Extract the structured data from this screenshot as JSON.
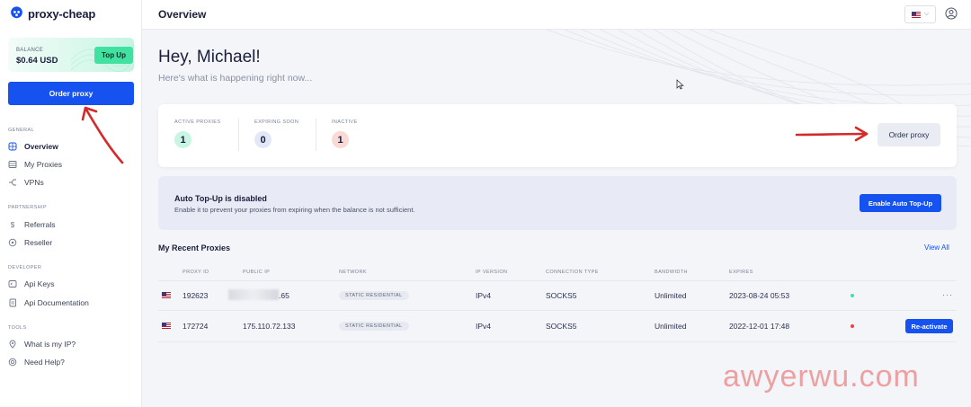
{
  "brand": {
    "name": "proxy-cheap"
  },
  "sidebar": {
    "balance_label": "BALANCE",
    "balance_value": "$0.64 USD",
    "topup_label": "Top Up",
    "order_label": "Order proxy",
    "sections": {
      "general": "GENERAL",
      "partnership": "PARTNERSHIP",
      "developer": "DEVELOPER",
      "tools": "TOOLS"
    },
    "items": [
      {
        "label": "Overview",
        "icon": "globe-icon"
      },
      {
        "label": "My Proxies",
        "icon": "list-icon"
      },
      {
        "label": "VPNs",
        "icon": "vpn-icon"
      },
      {
        "label": "Referrals",
        "icon": "dollar-icon"
      },
      {
        "label": "Reseller",
        "icon": "tag-icon"
      },
      {
        "label": "Api Keys",
        "icon": "key-icon"
      },
      {
        "label": "Api Documentation",
        "icon": "doc-icon"
      },
      {
        "label": "What is my IP?",
        "icon": "location-icon"
      },
      {
        "label": "Need Help?",
        "icon": "help-icon"
      }
    ]
  },
  "header": {
    "title": "Overview"
  },
  "main": {
    "greeting": "Hey, Michael!",
    "subgreeting": "Here's what is happening right now...",
    "stats": [
      {
        "label": "ACTIVE PROXIES",
        "value": "1",
        "color": "#c9f5e3"
      },
      {
        "label": "EXPIRING SOON",
        "value": "0",
        "color": "#e4e7f7"
      },
      {
        "label": "INACTIVE",
        "value": "1",
        "color": "#fbd9d4"
      }
    ],
    "order_label": "Order proxy",
    "autotopup": {
      "title": "Auto Top-Up is disabled",
      "description": "Enable it to prevent your proxies from expiring when the balance is not sufficient.",
      "button": "Enable Auto Top-Up"
    },
    "recent": {
      "title": "My Recent Proxies",
      "view_all": "View All",
      "columns": [
        "PROXY ID",
        "PUBLIC IP",
        "NETWORK",
        "IP VERSION",
        "CONNECTION TYPE",
        "BANDWIDTH",
        "EXPIRES"
      ],
      "rows": [
        {
          "id": "192623",
          "ip": "65",
          "network": "STATIC RESIDENTIAL",
          "version": "IPv4",
          "type": "SOCKS5",
          "bandwidth": "Unlimited",
          "expires": "2023-08-24 05:53",
          "status_color": "#41e1a2",
          "action": "···"
        },
        {
          "id": "172724",
          "ip": "175.110.72.133",
          "network": "STATIC RESIDENTIAL",
          "version": "IPv4",
          "type": "SOCKS5",
          "bandwidth": "Unlimited",
          "expires": "2022-12-01 17:48",
          "status_color": "#e8453c",
          "action": "Re-activate"
        }
      ]
    }
  },
  "watermark": "awyerwu.com",
  "annotation_color": "#d42a2a"
}
